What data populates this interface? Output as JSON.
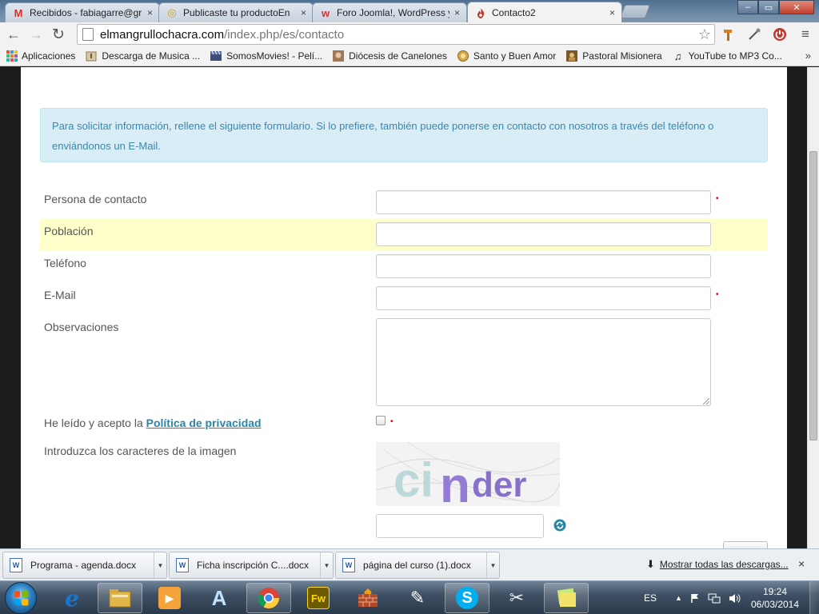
{
  "browser": {
    "tabs": [
      {
        "label": "Recibidos - fabiagarre@gr",
        "icon": "gmail-icon",
        "favicon_text": "M",
        "favicon_color": "#d93025"
      },
      {
        "label": "Publicaste tu productoEn",
        "icon": "mercadolibre-icon",
        "favicon_text": "◎",
        "favicon_color": "#c9a21a"
      },
      {
        "label": "Foro Joomla!, WordPress y",
        "icon": "forum-icon",
        "favicon_text": "w",
        "favicon_color": "#d0333a"
      },
      {
        "label": "Contacto2",
        "icon": "flame-icon",
        "favicon_text": "🔥",
        "favicon_color": "#c0392b"
      }
    ],
    "tab_close": "×",
    "window_controls": {
      "minimize": "–",
      "maximize": "▭",
      "close": "✕"
    },
    "address": {
      "host": "elmangrullochacra.com",
      "path": "/index.php/es/contacto"
    },
    "nav": {
      "back": "←",
      "forward": "→",
      "reload": "↻",
      "star": "☆",
      "menu": "≡"
    },
    "bookmarks": [
      {
        "label": "Aplicaciones",
        "icon": "apps-grid-icon"
      },
      {
        "label": "Descarga de Musica ...",
        "icon": "music-download-icon"
      },
      {
        "label": "SomosMovies! - Pelí...",
        "icon": "clapperboard-icon"
      },
      {
        "label": "Diócesis de Canelones",
        "icon": "diocese-icon"
      },
      {
        "label": "Santo y Buen Amor",
        "icon": "seal-icon"
      },
      {
        "label": "Pastoral Misionera",
        "icon": "pastoral-icon"
      },
      {
        "label": "YouTube to MP3 Co...",
        "icon": "music-note-icon"
      }
    ],
    "bookmarks_more": "»"
  },
  "page": {
    "info_text": "Para solicitar información, rellene el siguiente formulario. Si lo prefiere, también puede ponerse en contacto con nosotros  a través del teléfono o enviándonos un E-Mail.",
    "fields": {
      "contact": {
        "label": "Persona de contacto",
        "value": "",
        "required": true
      },
      "town": {
        "label": "Población",
        "value": ""
      },
      "phone": {
        "label": "Teléfono",
        "value": ""
      },
      "email": {
        "label": "E-Mail",
        "value": "",
        "required": true
      },
      "notes": {
        "label": "Observaciones",
        "value": ""
      }
    },
    "privacy_prefix": "He leído y acepto la ",
    "privacy_link": "Política de privacidad",
    "captcha_label": "Introduzca los caracteres de la imagen",
    "captcha_text": "cinder",
    "required_mark": "•",
    "colors": {
      "info_bg": "#d9edf7",
      "info_text": "#3a87ad",
      "highlight_row": "#ffffcc",
      "link": "#2a85a8",
      "required": "#cc0000"
    }
  },
  "downloads": {
    "items": [
      {
        "label": "Programa - agenda.docx",
        "icon": "word-doc-icon"
      },
      {
        "label": "Ficha inscripción C....docx",
        "icon": "word-doc-icon"
      },
      {
        "label": "página del curso (1).docx",
        "icon": "word-doc-icon"
      }
    ],
    "show_all": "Mostrar todas las descargas...",
    "close": "×"
  },
  "taskbar": {
    "apps": [
      {
        "name": "internet-explorer-icon",
        "glyph": "e",
        "color": "#1a75cf"
      },
      {
        "name": "file-explorer-icon",
        "glyph": "",
        "color": "#e2b74a"
      },
      {
        "name": "media-player-icon",
        "glyph": "▶",
        "color": "#e07b1e"
      },
      {
        "name": "arduino-like-icon",
        "glyph": "A",
        "color": "#2c6fbf"
      },
      {
        "name": "chrome-icon",
        "glyph": "",
        "color": "#db4437"
      },
      {
        "name": "fireworks-icon",
        "glyph": "Fw",
        "color": "#d9b400"
      },
      {
        "name": "firewall-icon",
        "glyph": "▦",
        "color": "#b24a2a"
      },
      {
        "name": "pen-tool-icon",
        "glyph": "✎",
        "color": "#d0312d"
      },
      {
        "name": "skype-icon",
        "glyph": "S",
        "color": "#00aff0"
      },
      {
        "name": "scissors-icon",
        "glyph": "✂",
        "color": "#c0392b"
      },
      {
        "name": "sticky-notes-icon",
        "glyph": "",
        "color": "#f1e36b"
      }
    ],
    "language": "ES",
    "time": "19:24",
    "date": "06/03/2014"
  }
}
